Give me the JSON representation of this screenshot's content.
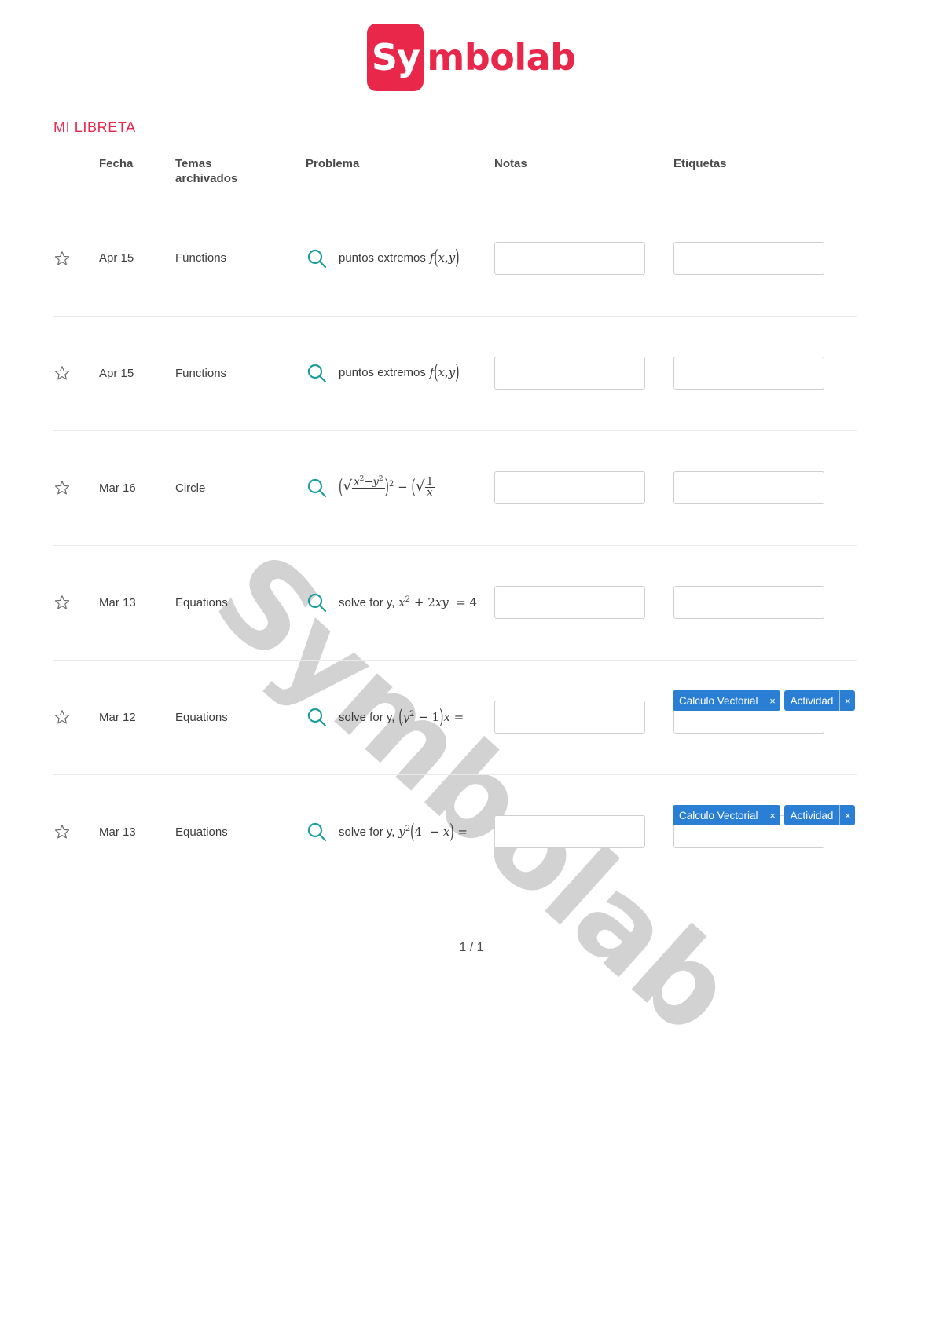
{
  "brand": {
    "mark_text": "Sy",
    "name_text": "mbolab",
    "color": "#e8274b",
    "mark_bg": "#e8274b",
    "mark_fg": "#ffffff"
  },
  "section": {
    "title": "MI LIBRETA",
    "title_color": "#e8274b"
  },
  "watermark": {
    "text": "Symbolab",
    "color": "#d2d2d2"
  },
  "table": {
    "headers": {
      "star": "",
      "date": "Fecha",
      "topic_line1": "Temas",
      "topic_line2": "archivados",
      "problem": "Problema",
      "notes": "Notas",
      "tags": "Etiquetas"
    },
    "rows": [
      {
        "starred": false,
        "star_icon": "star-outline-icon",
        "date": "Apr 15",
        "topic": "Functions",
        "search_icon": "search-icon",
        "problem_text": "puntos extremos",
        "problem_math": "f(x,y)",
        "note_value": "",
        "note_placeholder": "",
        "tags": []
      },
      {
        "starred": false,
        "star_icon": "star-outline-icon",
        "date": "Apr 15",
        "topic": "Functions",
        "search_icon": "search-icon",
        "problem_text": "puntos extremos",
        "problem_math": "f(x,y)",
        "note_value": "",
        "note_placeholder": "",
        "tags": []
      },
      {
        "starred": false,
        "star_icon": "star-outline-icon",
        "date": "Mar 16",
        "topic": "Circle",
        "search_icon": "search-icon",
        "problem_text": "",
        "problem_math": "(√(x²−y²))² − (√(1/x))",
        "note_value": "",
        "note_placeholder": "",
        "tags": []
      },
      {
        "starred": false,
        "star_icon": "star-outline-icon",
        "date": "Mar 13",
        "topic": "Equations",
        "search_icon": "search-icon",
        "problem_text": "solve for y,",
        "problem_math": "x² + 2xy = 4",
        "note_value": "",
        "note_placeholder": "",
        "tags": []
      },
      {
        "starred": false,
        "star_icon": "star-outline-icon",
        "date": "Mar 12",
        "topic": "Equations",
        "search_icon": "search-icon",
        "problem_text": "solve for y,",
        "problem_math": "(y²−1)x =",
        "note_value": "",
        "note_placeholder": "",
        "tags": [
          {
            "label": "Calculo Vectorial",
            "close": "×",
            "color": "#2a7fd4"
          },
          {
            "label": "Actividad",
            "close": "×",
            "color": "#2a7fd4"
          }
        ]
      },
      {
        "starred": false,
        "star_icon": "star-outline-icon",
        "date": "Mar 13",
        "topic": "Equations",
        "search_icon": "search-icon",
        "problem_text": "solve for y,",
        "problem_math": "y²(4 − x) =",
        "note_value": "",
        "note_placeholder": "",
        "tags": [
          {
            "label": "Calculo Vectorial",
            "close": "×",
            "color": "#2a7fd4"
          },
          {
            "label": "Actividad",
            "close": "×",
            "color": "#2a7fd4"
          }
        ]
      }
    ]
  },
  "pagination": {
    "label": "1 / 1"
  }
}
